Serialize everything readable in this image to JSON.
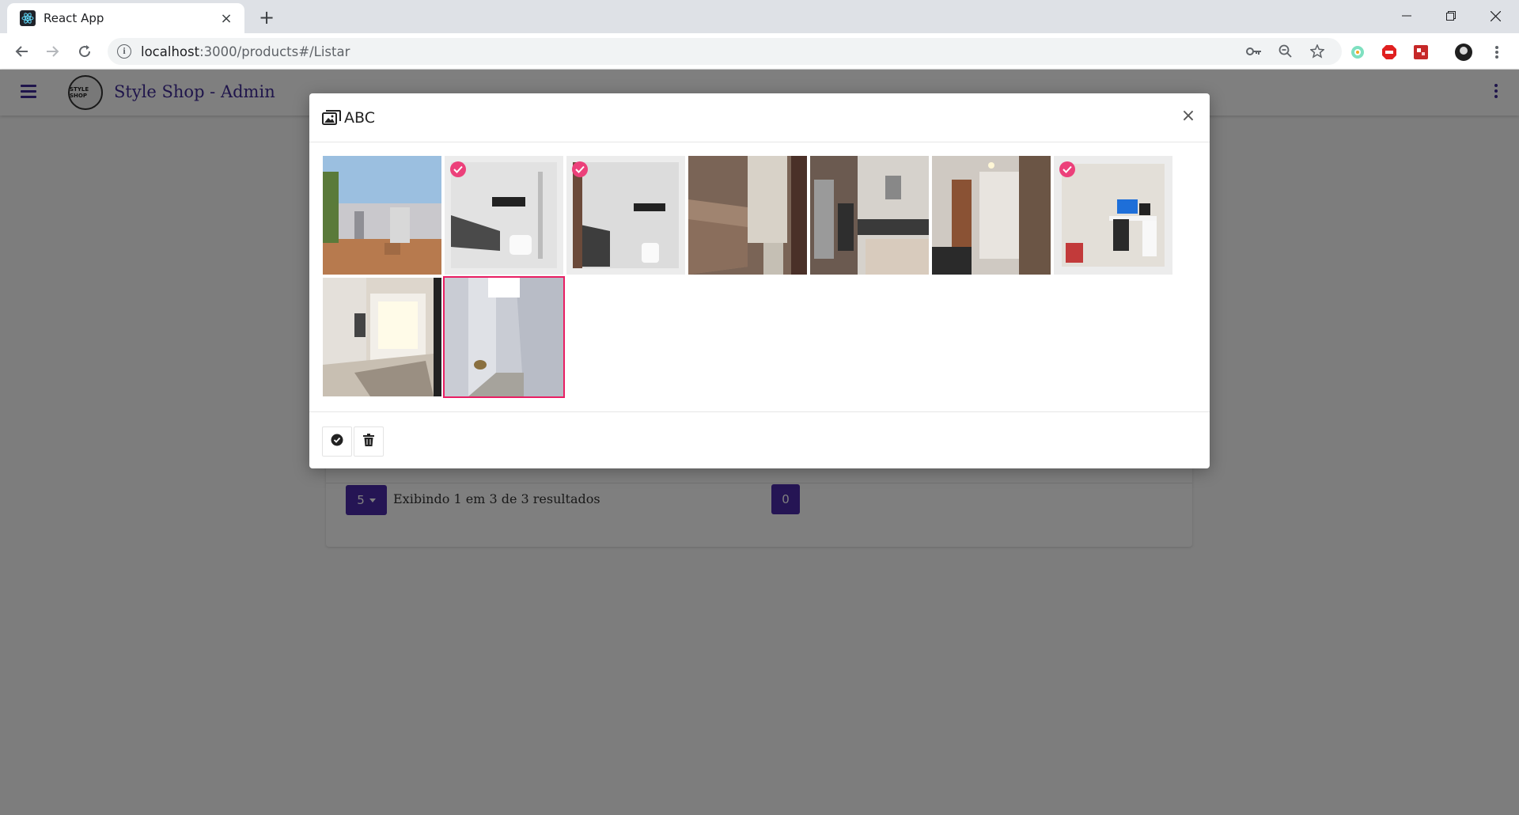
{
  "browser": {
    "tab_title": "React App",
    "url_host": "localhost",
    "url_path": ":3000/products#/Listar"
  },
  "app": {
    "brand": "Style Shop - Admin",
    "logo_text": "STYLE SHOP"
  },
  "listing": {
    "page_size": "5",
    "results_text": "Exibindo 1 em 3 de 3 resultados",
    "current_page": "0"
  },
  "modal": {
    "title": "ABC",
    "close_label": "×",
    "images": [
      {
        "name": "house-exterior",
        "selected": false,
        "focused": false
      },
      {
        "name": "bathroom-1",
        "selected": true,
        "focused": false
      },
      {
        "name": "bathroom-2",
        "selected": true,
        "focused": false
      },
      {
        "name": "living-room-sofa",
        "selected": false,
        "focused": false
      },
      {
        "name": "kitchen",
        "selected": false,
        "focused": false
      },
      {
        "name": "hallway-door",
        "selected": false,
        "focused": false
      },
      {
        "name": "office-desk",
        "selected": true,
        "focused": false
      },
      {
        "name": "garage-entrance",
        "selected": false,
        "focused": false
      },
      {
        "name": "side-corridor",
        "selected": false,
        "focused": true
      }
    ],
    "footer": {
      "confirm_icon": "check-circle-icon",
      "delete_icon": "trash-icon"
    }
  },
  "colors": {
    "accent": "#4b2aa8",
    "brand": "#3f2b96",
    "selection": "#ec407a"
  }
}
